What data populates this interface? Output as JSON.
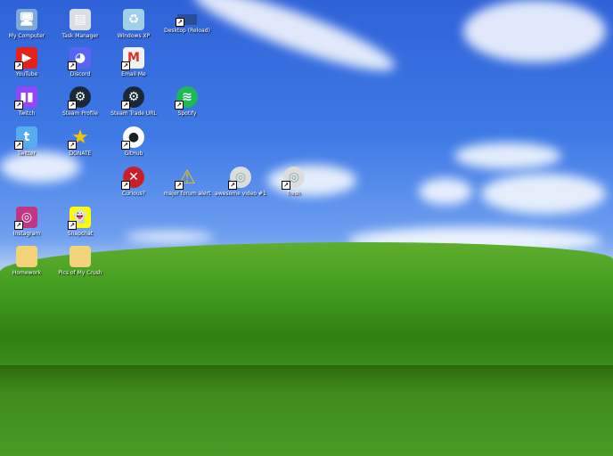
{
  "desktop": {
    "icons": [
      {
        "label": "My Computer",
        "icon": "computer-icon",
        "shortcut": false
      },
      {
        "label": "Task Manager",
        "icon": "task-manager-icon",
        "shortcut": false
      },
      {
        "label": "Windows XP",
        "icon": "recycle-bin-icon",
        "shortcut": false
      },
      {
        "label": "Desktop (Reload)",
        "icon": "desktop-icon",
        "shortcut": true
      },
      {
        "label": "YouTube",
        "icon": "youtube-icon",
        "shortcut": true
      },
      {
        "label": "Discord",
        "icon": "discord-icon",
        "shortcut": true
      },
      {
        "label": "Email Me",
        "icon": "gmail-icon",
        "shortcut": true
      },
      {
        "label": "Twitch",
        "icon": "twitch-icon",
        "shortcut": true
      },
      {
        "label": "Steam Profile",
        "icon": "steam-icon",
        "shortcut": true
      },
      {
        "label": "Steam Trade URL",
        "icon": "steam-icon",
        "shortcut": true
      },
      {
        "label": "Spotify",
        "icon": "spotify-icon",
        "shortcut": true
      },
      {
        "label": "Twitter",
        "icon": "twitter-icon",
        "shortcut": true
      },
      {
        "label": "DONATE",
        "icon": "star-icon",
        "shortcut": true
      },
      {
        "label": "GitHub",
        "icon": "github-icon",
        "shortcut": true
      },
      {
        "label": "Curious?",
        "icon": "error-icon",
        "shortcut": true
      },
      {
        "label": "major forum alert",
        "icon": "warning-icon",
        "shortcut": true
      },
      {
        "label": "awesome video #1",
        "icon": "cd-icon",
        "shortcut": true
      },
      {
        "label": "fresh",
        "icon": "cd-icon",
        "shortcut": true
      },
      {
        "label": "Instagram",
        "icon": "instagram-icon",
        "shortcut": true
      },
      {
        "label": "Snapchat",
        "icon": "snapchat-icon",
        "shortcut": true
      },
      {
        "label": "Homework",
        "icon": "folder-icon",
        "shortcut": false
      },
      {
        "label": "Pics of My Crush",
        "icon": "folder-icon",
        "shortcut": false
      }
    ]
  }
}
